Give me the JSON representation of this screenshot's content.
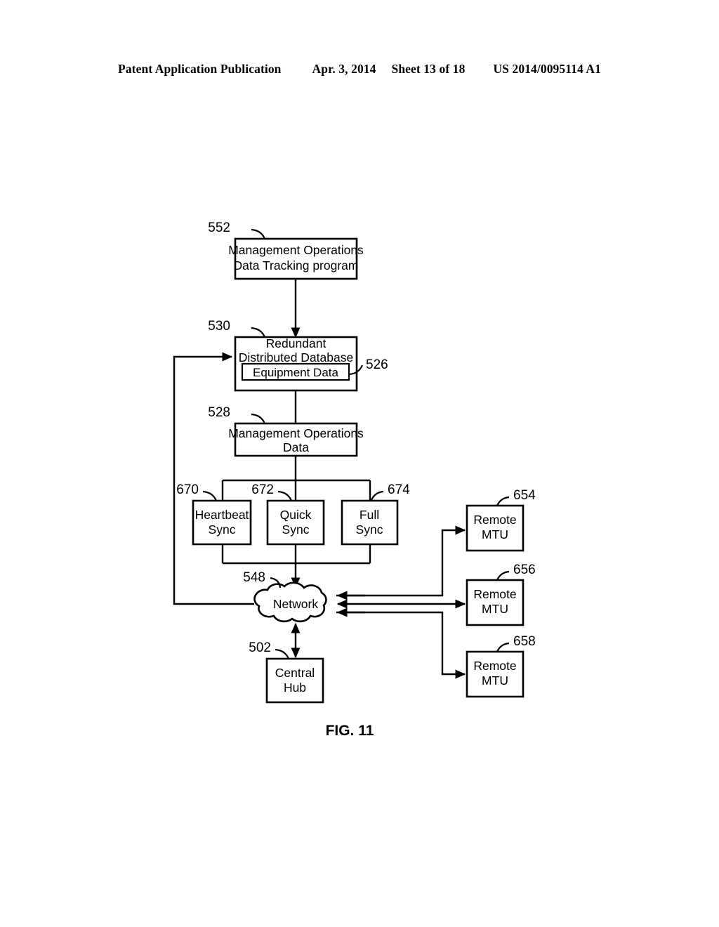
{
  "header": {
    "publication": "Patent Application Publication",
    "date": "Apr. 3, 2014",
    "sheet": "Sheet 13 of 18",
    "patent_number": "US 2014/0095114 A1"
  },
  "figure": {
    "label": "FIG. 11",
    "nodes": {
      "tracking_program": {
        "ref": "552",
        "line1": "Management Operations",
        "line2": "Data Tracking program"
      },
      "redundant_db": {
        "ref": "530",
        "line1": "Redundant",
        "line2": "Distributed Database"
      },
      "equipment_data": {
        "ref": "526",
        "label": "Equipment Data"
      },
      "management_ops_data": {
        "ref": "528",
        "line1": "Management Operations",
        "line2": "Data"
      },
      "heartbeat_sync": {
        "ref": "670",
        "line1": "Heartbeat",
        "line2": "Sync"
      },
      "quick_sync": {
        "ref": "672",
        "line1": "Quick",
        "line2": "Sync"
      },
      "full_sync": {
        "ref": "674",
        "line1": "Full",
        "line2": "Sync"
      },
      "network": {
        "ref": "548",
        "label": "Network"
      },
      "central_hub": {
        "ref": "502",
        "line1": "Central",
        "line2": "Hub"
      },
      "remote_mtu_654": {
        "ref": "654",
        "line1": "Remote",
        "line2": "MTU"
      },
      "remote_mtu_656": {
        "ref": "656",
        "line1": "Remote",
        "line2": "MTU"
      },
      "remote_mtu_658": {
        "ref": "658",
        "line1": "Remote",
        "line2": "MTU"
      }
    },
    "colors": {
      "ink": "#000000",
      "paper": "#ffffff"
    }
  }
}
